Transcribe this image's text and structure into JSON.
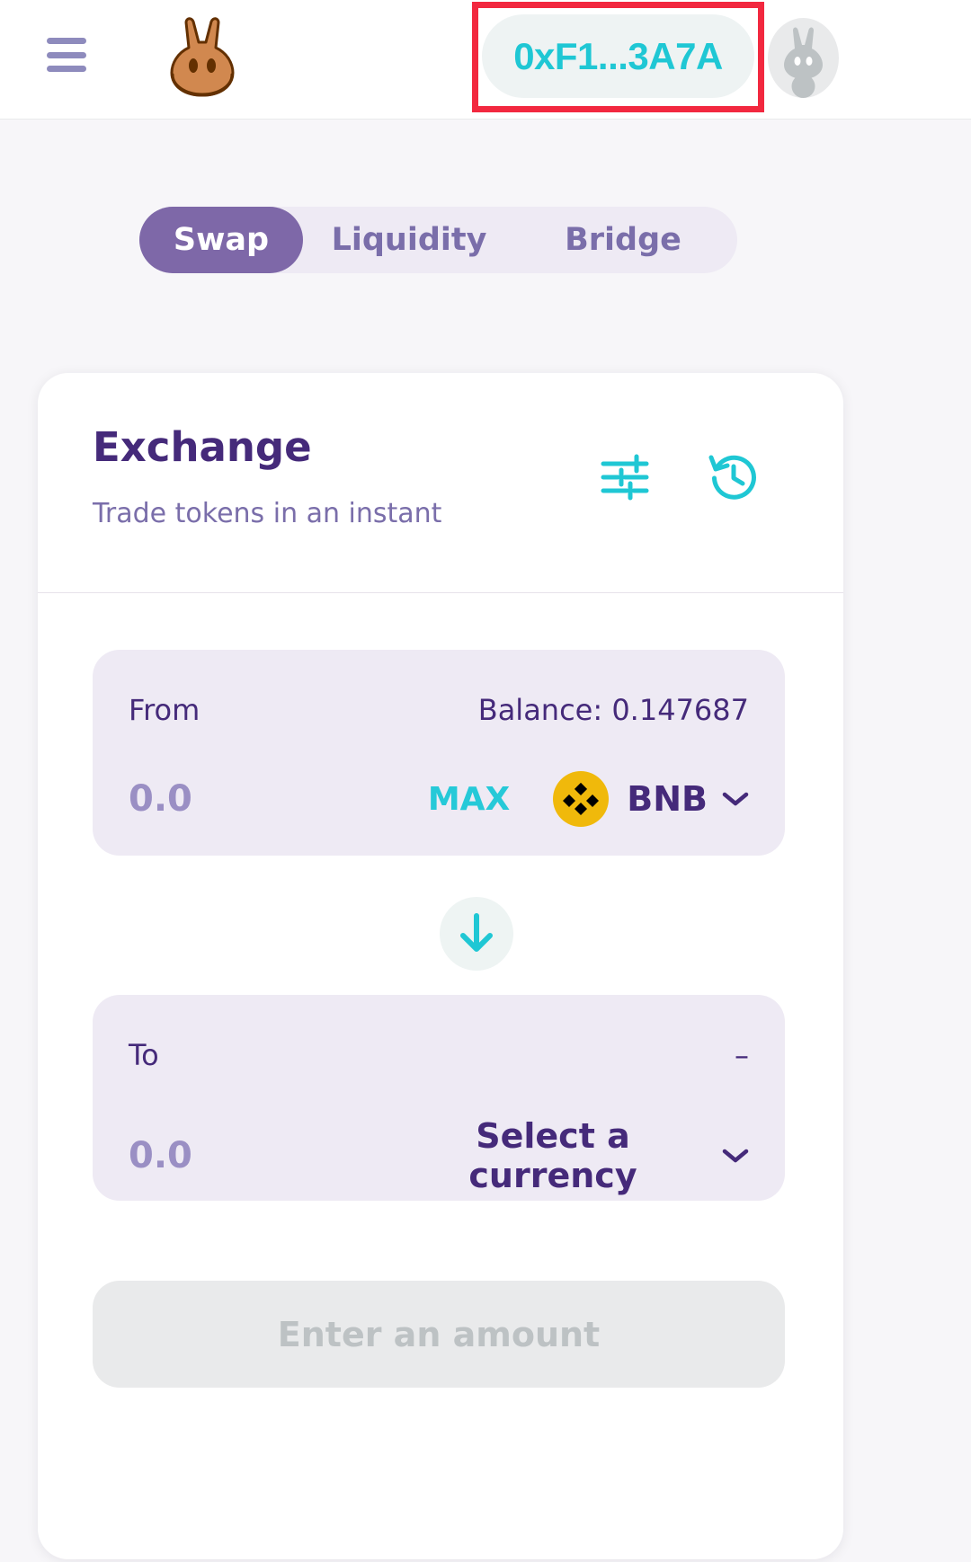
{
  "header": {
    "menu_icon": "hamburger-menu-icon",
    "logo_icon": "pancakeswap-rabbit-logo",
    "wallet_label": "0xF1...3A7A",
    "avatar_icon": "user-avatar-rabbit-icon",
    "highlight_color": "#f2283f",
    "wallet_text_color": "#1fc7d4"
  },
  "tabs": {
    "items": [
      {
        "label": "Swap",
        "active": true
      },
      {
        "label": "Liquidity",
        "active": false
      },
      {
        "label": "Bridge",
        "active": false
      }
    ],
    "active_bg": "#7e68a8",
    "track_bg": "#eeeaf4"
  },
  "exchange": {
    "title": "Exchange",
    "subtitle": "Trade tokens in an instant",
    "settings_icon": "sliders-settings-icon",
    "history_icon": "history-clock-icon",
    "icon_color": "#1fc7d4"
  },
  "from_panel": {
    "label": "From",
    "balance_label": "Balance: 0.147687",
    "amount_value": "",
    "amount_placeholder": "0.0",
    "max_label": "MAX",
    "token_symbol": "BNB",
    "token_icon": "binance-bnb-coin-icon",
    "chevron_icon": "chevron-down-icon"
  },
  "switch_button": {
    "icon": "arrow-down-icon",
    "color": "#1fc7d4"
  },
  "to_panel": {
    "label": "To",
    "balance_label": "–",
    "amount_value": "",
    "amount_placeholder": "0.0",
    "select_label": "Select a currency",
    "chevron_icon": "chevron-down-icon"
  },
  "cta": {
    "label": "Enter an amount",
    "disabled": true
  }
}
